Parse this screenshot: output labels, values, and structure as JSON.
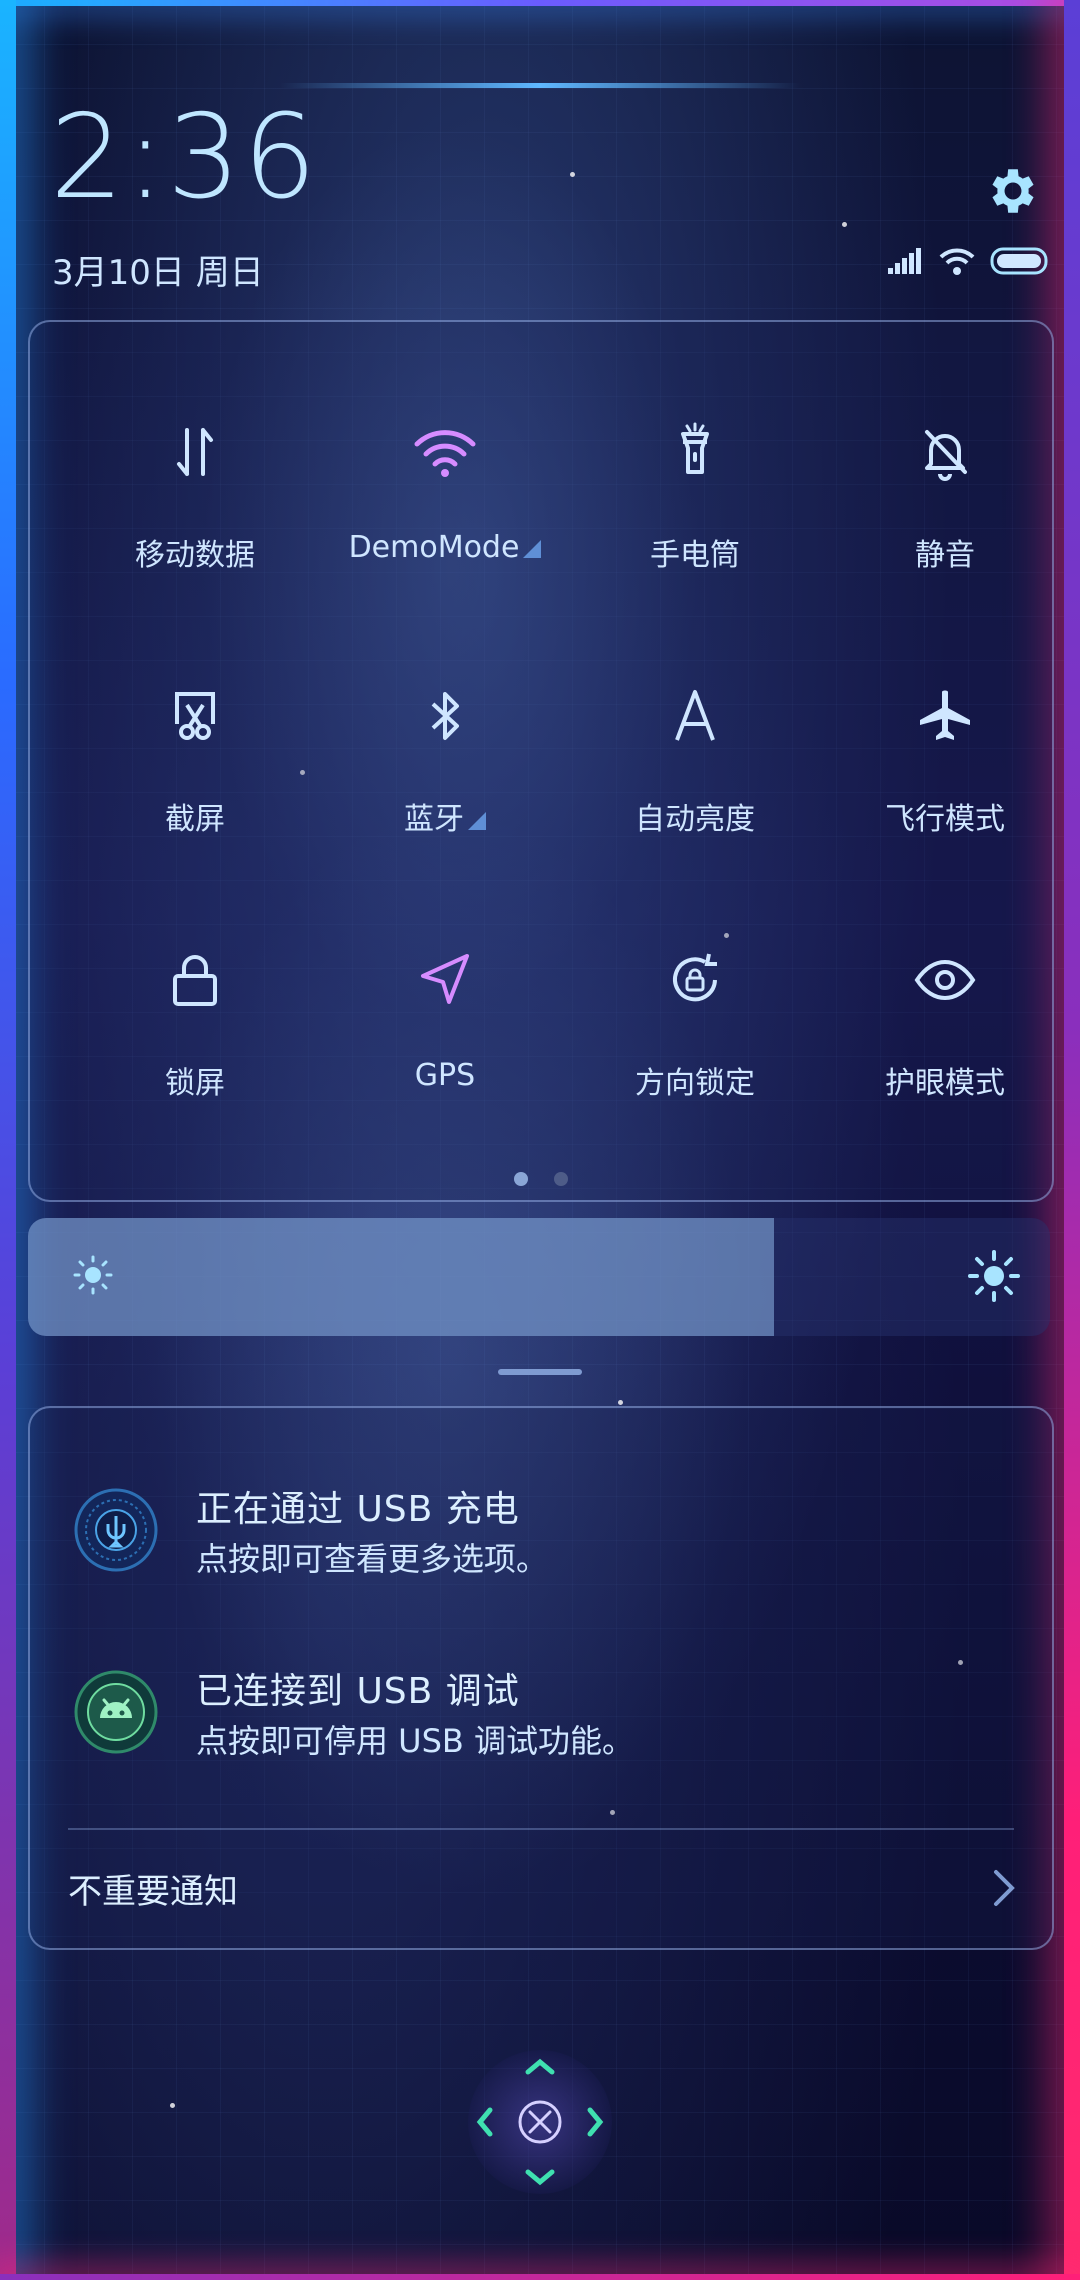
{
  "status": {
    "time": "2:36",
    "date": "3月10日 周日"
  },
  "quick_settings": {
    "tiles": [
      {
        "label": "移动数据",
        "icon": "mobile-data-icon",
        "accent": "#cfe6ff"
      },
      {
        "label": "DemoMode",
        "icon": "wifi-icon",
        "accent": "#d68cff",
        "expandable": true
      },
      {
        "label": "手电筒",
        "icon": "flashlight-icon",
        "accent": "#cfe6ff"
      },
      {
        "label": "静音",
        "icon": "mute-bell-icon",
        "accent": "#cfe6ff"
      },
      {
        "label": "截屏",
        "icon": "screenshot-icon",
        "accent": "#cfe6ff"
      },
      {
        "label": "蓝牙",
        "icon": "bluetooth-icon",
        "accent": "#cfe6ff",
        "expandable": true
      },
      {
        "label": "自动亮度",
        "icon": "auto-brightness-icon",
        "accent": "#cfe6ff"
      },
      {
        "label": "飞行模式",
        "icon": "airplane-icon",
        "accent": "#cfe6ff"
      },
      {
        "label": "锁屏",
        "icon": "lock-icon",
        "accent": "#cfe6ff"
      },
      {
        "label": "GPS",
        "icon": "gps-icon",
        "accent": "#d68cff"
      },
      {
        "label": "方向锁定",
        "icon": "rotation-lock-icon",
        "accent": "#cfe6ff"
      },
      {
        "label": "护眼模式",
        "icon": "eye-icon",
        "accent": "#cfe6ff"
      }
    ],
    "page_count": 2,
    "current_page": 1
  },
  "brightness": {
    "level": 0.73
  },
  "notifications": [
    {
      "title": "正在通过 USB 充电",
      "text": "点按即可查看更多选项。",
      "icon": "usb-charge-icon"
    },
    {
      "title": "已连接到 USB 调试",
      "text": "点按即可停用 USB 调试功能。",
      "icon": "android-debug-icon"
    }
  ],
  "unimportant": {
    "label": "不重要通知"
  },
  "colors": {
    "accent_blue": "#5fb8ff",
    "accent_pink": "#ff1f78",
    "icon_purple": "#d68cff"
  }
}
